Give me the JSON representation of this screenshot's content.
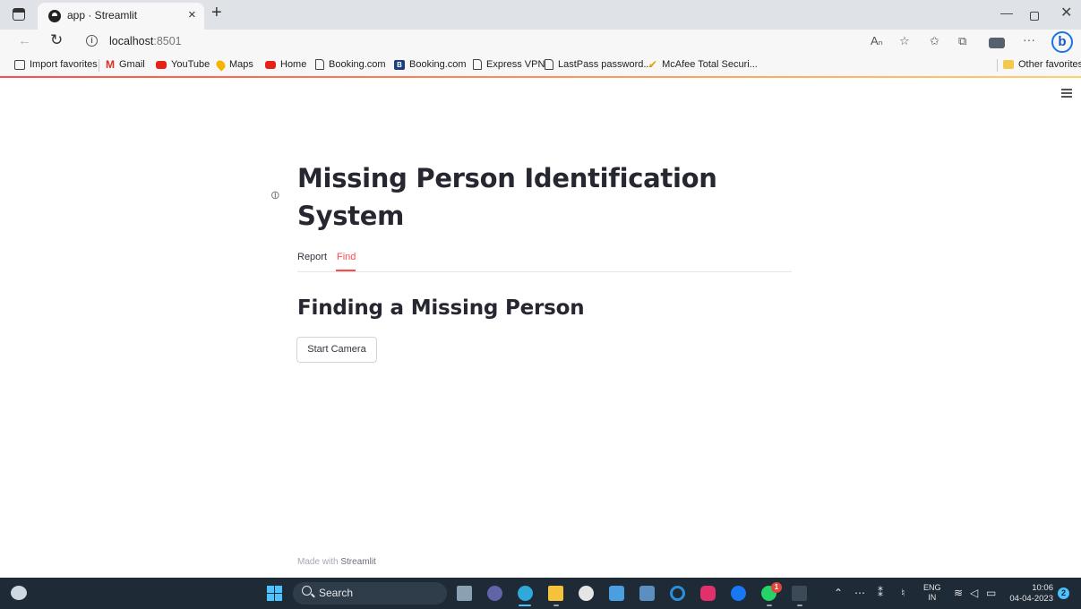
{
  "browser": {
    "tab_title": "app · Streamlit",
    "tab_close": "×",
    "new_tab": "+",
    "url_host": "localhost",
    "url_port": ":8501",
    "window_controls": {
      "minimize": "—",
      "close": "✕"
    },
    "toolbar_icons": {
      "read_aloud": "Aₙ",
      "favorite": "☆",
      "favorites": "✩",
      "collections": "⧉",
      "more": "···",
      "copilot": "b"
    }
  },
  "bookmarks": {
    "items": [
      "Import favorites",
      "Gmail",
      "YouTube",
      "Maps",
      "Home",
      "Booking.com",
      "Booking.com",
      "Express VPN",
      "LastPass password...",
      "McAfee Total Securi..."
    ],
    "other": "Other favorites"
  },
  "app": {
    "title": "Missing Person Identification System",
    "tabs": [
      {
        "label": "Report",
        "selected": false
      },
      {
        "label": "Find",
        "selected": true
      }
    ],
    "section_heading": "Finding a Missing Person",
    "start_camera_label": "Start Camera",
    "footer_prefix": "Made with ",
    "footer_brand": "Streamlit",
    "accent_color": "#ff4b4b"
  },
  "taskbar": {
    "search_label": "Search",
    "whatsapp_badge": "1",
    "lang_line1": "ENG",
    "lang_line2": "IN",
    "time": "10:06",
    "date": "04-04-2023",
    "notification_count": "2"
  }
}
